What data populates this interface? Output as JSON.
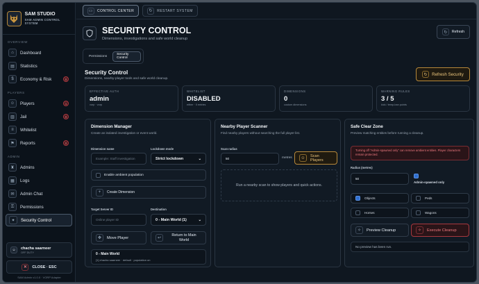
{
  "brand": {
    "title": "SAM STUDIO",
    "subtitle": "SAM ADMIN CONTROL SYSTEM"
  },
  "sidebar": {
    "sections": {
      "overview": "OVERVIEW",
      "players": "PLAYERS",
      "admin": "ADMIN"
    },
    "items": [
      {
        "label": "Dashboard",
        "icon": "home-icon"
      },
      {
        "label": "Statistics",
        "icon": "chart-icon"
      },
      {
        "label": "Economy & Risk",
        "icon": "coin-icon",
        "badge": "0"
      },
      {
        "label": "Players",
        "icon": "users-icon",
        "badge": "1"
      },
      {
        "label": "Jail",
        "icon": "lock-icon",
        "badge": "0"
      },
      {
        "label": "Whitelist",
        "icon": "list-icon"
      },
      {
        "label": "Reports",
        "icon": "flag-icon",
        "badge": "0"
      },
      {
        "label": "Admins",
        "icon": "admin-icon"
      },
      {
        "label": "Logs",
        "icon": "logs-icon"
      },
      {
        "label": "Admin Chat",
        "icon": "chat-icon"
      },
      {
        "label": "Permissions",
        "icon": "key-icon"
      },
      {
        "label": "Security Control",
        "icon": "tool-icon"
      }
    ],
    "user": {
      "name": "chacha saarneer",
      "status": "OFF DUTY"
    },
    "close_label": "CLOSE · ESC",
    "version": "SAM Admin v1.0.0 · VORP Adapter"
  },
  "topbar": {
    "control_center": "CONTROL CENTER",
    "restart_system": "RESTART SYSTEM"
  },
  "header": {
    "title": "SECURITY CONTROL",
    "subtitle": "Dimensions, investigations and safe world cleanup",
    "refresh": "Refresh"
  },
  "tabs": {
    "permissions": "Permissions",
    "security": "Security Control"
  },
  "section": {
    "title": "Security Control",
    "subtitle": "Dimensions, nearby-player tools and safe world cleanup.",
    "refresh": "Refresh Security"
  },
  "stats": [
    {
      "label": "EFFECTIVE AUTH",
      "value": "admin",
      "sub": "vorp · vorp"
    },
    {
      "label": "WHITELIST",
      "value": "DISABLED",
      "sub": "either · 0 entries"
    },
    {
      "label": "DIMENSIONS",
      "value": "0",
      "sub": "custom dimensions"
    },
    {
      "label": "WARNING RULES",
      "value": "3 / 5",
      "sub": "kick / temp-ban points"
    }
  ],
  "dimension": {
    "title": "Dimension Manager",
    "subtitle": "Create an isolated investigation or event world.",
    "name_label": "Dimension name",
    "name_placeholder": "Example: Staff investigation",
    "lockdown_label": "Lockdown mode",
    "lockdown_value": "Strict lockdown",
    "ambient_label": "Enable ambient population",
    "create_label": "Create Dimension",
    "target_label": "Target Server ID",
    "target_placeholder": "Online player ID",
    "dest_label": "Destination",
    "dest_value": "0 - Main World (1)",
    "move_label": "Move Player",
    "return_label": "Return to Main World",
    "world_title": "0 - Main World",
    "world_info": "[1] chacha saarneer · default · population on"
  },
  "scanner": {
    "title": "Nearby Player Scanner",
    "subtitle": "Find nearby players without searching the full player list.",
    "radius_label": "Scan radius",
    "radius_value": "50",
    "unit": "metres",
    "scan_label": "Scan Players",
    "empty": "Run a nearby scan to show players and quick actions."
  },
  "clear": {
    "title": "Safe Clear Zone",
    "subtitle": "Preview matching entities before running a cleanup.",
    "warning": "Turning off \"Admin-spawned only\" can remove ambient entities. Player characters remain protected.",
    "radius_label": "Radius (metres)",
    "radius_value": "50",
    "admin_only": "Admin-spawned only",
    "options": [
      {
        "label": "Objects",
        "checked": true
      },
      {
        "label": "Peds",
        "checked": false
      },
      {
        "label": "Horses",
        "checked": false
      },
      {
        "label": "Wagons",
        "checked": false
      }
    ],
    "preview_label": "Preview Cleanup",
    "execute_label": "Execute Cleanup",
    "no_preview": "No preview has been run."
  }
}
